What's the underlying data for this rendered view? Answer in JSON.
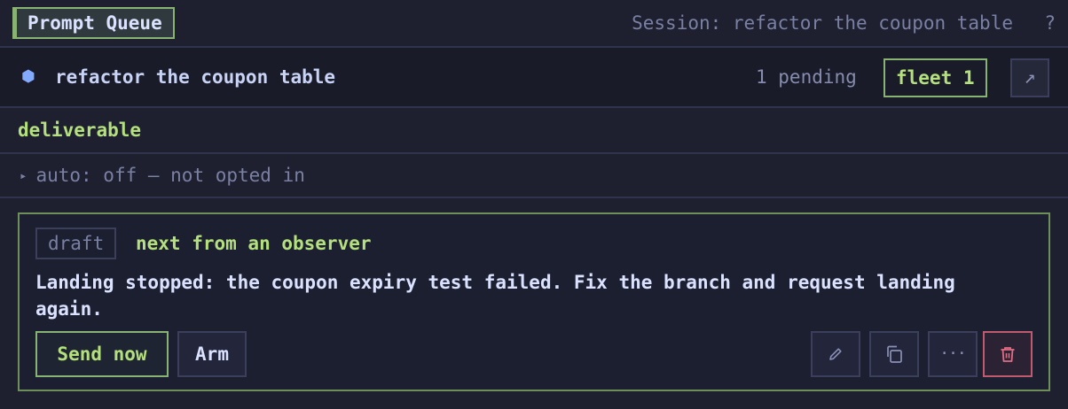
{
  "header": {
    "active_tab": "Prompt Queue",
    "session_label": "Session: refactor the coupon table",
    "help": "?"
  },
  "thread": {
    "icon": "hexagon-icon",
    "icon_glyph": "⬢",
    "title": "refactor the coupon table",
    "pending": "1 pending",
    "fleet": "fleet 1",
    "popout_glyph": "↗"
  },
  "section": {
    "label": "deliverable"
  },
  "auto": {
    "caret": "▸",
    "text": "auto: off — not opted in"
  },
  "card": {
    "badge": "draft",
    "source": "next from an observer",
    "message": "Landing stopped: the coupon expiry test failed. Fix the branch and request landing again.",
    "send_label": "Send now",
    "arm_label": "Arm",
    "more_glyph": "···",
    "colors": {
      "accent": "#b5e07e",
      "danger": "#e06c84",
      "border": "#6e8f5a"
    }
  }
}
